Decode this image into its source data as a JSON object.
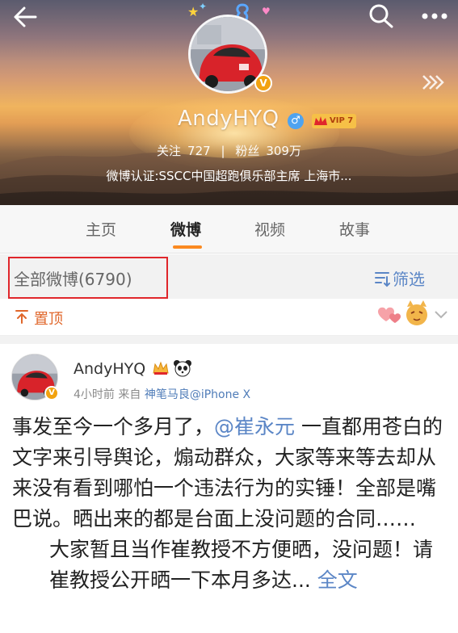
{
  "header": {
    "profile_name": "AndyHYQ",
    "gender_symbol": "♂",
    "vip_label": "VIP 7",
    "avatar_badge": "V",
    "follow_label": "关注",
    "follow_count": "727",
    "separator": "|",
    "fans_label": "粉丝",
    "fans_count": "309万",
    "verification": "微博认证:SSCC中国超跑俱乐部主席 上海市..."
  },
  "tabs": [
    {
      "label": "主页",
      "active": false
    },
    {
      "label": "微博",
      "active": true
    },
    {
      "label": "视频",
      "active": false
    },
    {
      "label": "故事",
      "active": false
    }
  ],
  "filter": {
    "all_posts_label": "全部微博(6790)",
    "filter_label": "筛选"
  },
  "pinned": {
    "label": "置顶"
  },
  "post": {
    "author": "AndyHYQ",
    "time": "4小时前",
    "from_label": "来自",
    "source": "神笔马良@iPhone X",
    "text_before_mention": "事发至今一个多月了，",
    "mention": "@崔永元",
    "text_after_mention": " 一直都用苍白的文字来引导舆论，煽动群众，大家等来等去却从来没有看到哪怕一个违法行为的实锤！全部是嘴巴说。晒出来的都是台面上没问题的合同……",
    "second_paragraph": "大家暂且当作崔教授不方便晒，没问题！请崔教授公开晒一下本月多达...",
    "full_text_link": " 全文"
  },
  "icons": {
    "back": "back-arrow-icon",
    "search": "search-icon",
    "more": "more-icon",
    "filter": "filter-icon",
    "pin": "pin-icon",
    "caret": "chevron-down-icon"
  },
  "colors": {
    "accent_orange": "#fb8a21",
    "link_blue": "#5b86c6",
    "highlight_red": "#e0262b",
    "pin_orange": "#e0662a"
  }
}
